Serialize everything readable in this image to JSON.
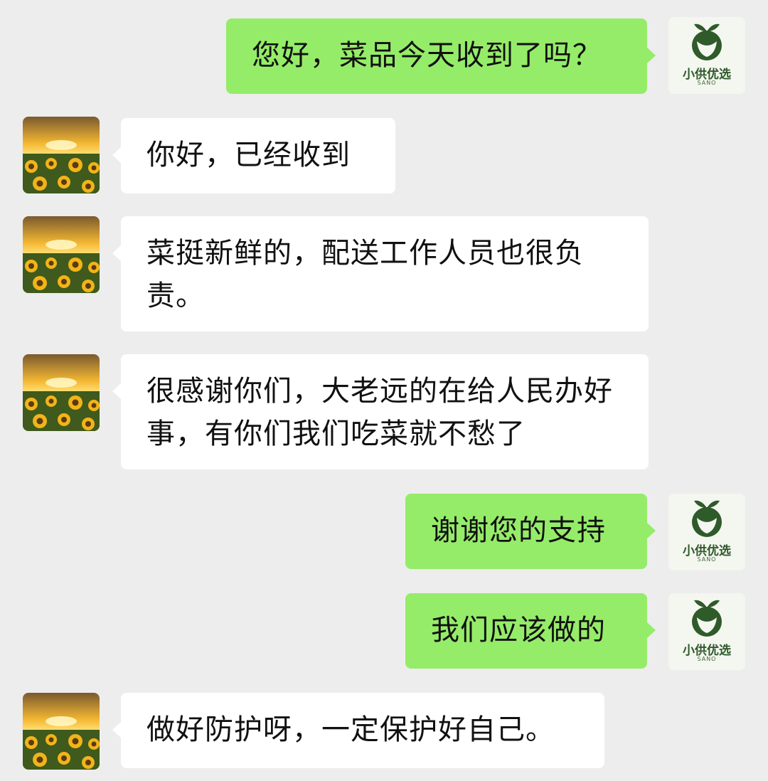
{
  "chat": {
    "messages": [
      {
        "side": "out",
        "sender": "seller",
        "text": "您好，菜品今天收到了吗？"
      },
      {
        "side": "in",
        "sender": "customer",
        "text": "你好，已经收到"
      },
      {
        "side": "in",
        "sender": "customer",
        "text": "菜挺新鲜的，配送工作人员也很负责。"
      },
      {
        "side": "in",
        "sender": "customer",
        "text": "很感谢你们，大老远的在给人民办好事，有你们我们吃菜就不愁了"
      },
      {
        "side": "out",
        "sender": "seller",
        "text": "谢谢您的支持"
      },
      {
        "side": "out",
        "sender": "seller",
        "text": "我们应该做的"
      },
      {
        "side": "in",
        "sender": "customer",
        "text": "做好防护呀，一定保护好自己。"
      }
    ]
  },
  "seller_avatar": {
    "icon": "green-leaf-logo-icon",
    "brand_name": "小供优选",
    "brand_sub": "SANO"
  },
  "customer_avatar": {
    "icon": "sunflower-sunset-avatar"
  },
  "colors": {
    "background": "#ededed",
    "outgoing_bubble": "#95ec69",
    "incoming_bubble": "#ffffff"
  }
}
